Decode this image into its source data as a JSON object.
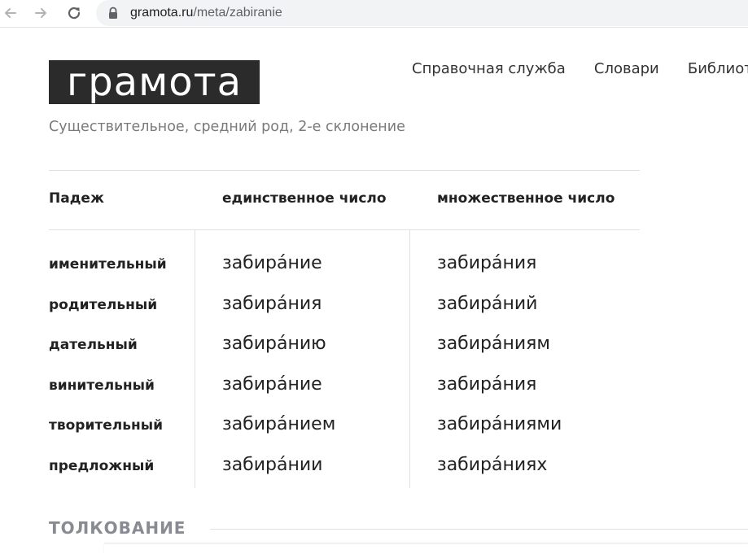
{
  "browser": {
    "url_domain": "gramota.ru",
    "url_path": "/meta/zabiranie"
  },
  "icons": {
    "back": "arrow-left-icon",
    "forward": "arrow-right-icon",
    "reload": "reload-icon",
    "lock": "lock-icon"
  },
  "header": {
    "logo": "грамота",
    "nav": [
      {
        "label": "Справочная служба"
      },
      {
        "label": "Словари"
      },
      {
        "label": "Библиот"
      }
    ]
  },
  "subtitle": "Существительное, средний род, 2-е склонение",
  "table": {
    "headers": {
      "case": "Падеж",
      "singular": "единственное число",
      "plural": "множественное число"
    },
    "rows": [
      {
        "case": "именительный",
        "singular": "забира́ние",
        "plural": "забира́ния"
      },
      {
        "case": "родительный",
        "singular": "забира́ния",
        "plural": "забира́ний"
      },
      {
        "case": "дательный",
        "singular": "забира́нию",
        "plural": "забира́ниям"
      },
      {
        "case": "винительный",
        "singular": "забира́ние",
        "plural": "забира́ния"
      },
      {
        "case": "творительный",
        "singular": "забира́нием",
        "plural": "забира́ниями"
      },
      {
        "case": "предложный",
        "singular": "забира́нии",
        "plural": "забира́ниях"
      }
    ]
  },
  "section": {
    "heading": "ТОЛКОВАНИЕ"
  },
  "colors": {
    "logo_bg": "#2b2b2b",
    "text": "#222222",
    "muted": "#7a7a7a",
    "section_heading": "#888c92",
    "rule": "#e0e0e0"
  }
}
